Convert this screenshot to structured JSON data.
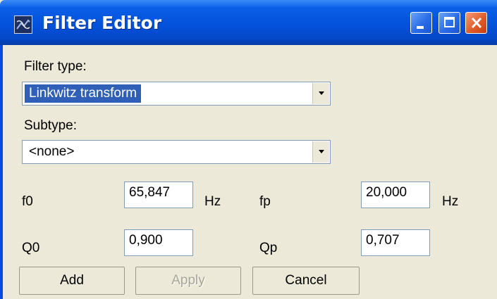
{
  "window": {
    "title": "Filter Editor"
  },
  "filter_type": {
    "label": "Filter type:",
    "selected": "Linkwitz transform"
  },
  "subtype": {
    "label": "Subtype:",
    "selected": "<none>"
  },
  "params": {
    "f0": {
      "label": "f0",
      "value": "65,847",
      "unit": "Hz"
    },
    "fp": {
      "label": "fp",
      "value": "20,000",
      "unit": "Hz"
    },
    "q0": {
      "label": "Q0",
      "value": "0,900"
    },
    "qp": {
      "label": "Qp",
      "value": "0,707"
    }
  },
  "buttons": {
    "add": "Add",
    "apply": "Apply",
    "cancel": "Cancel"
  },
  "colors": {
    "titlebar": "#0452dc",
    "selection": "#2f5fb7",
    "dialog_bg": "#ece9d8"
  }
}
